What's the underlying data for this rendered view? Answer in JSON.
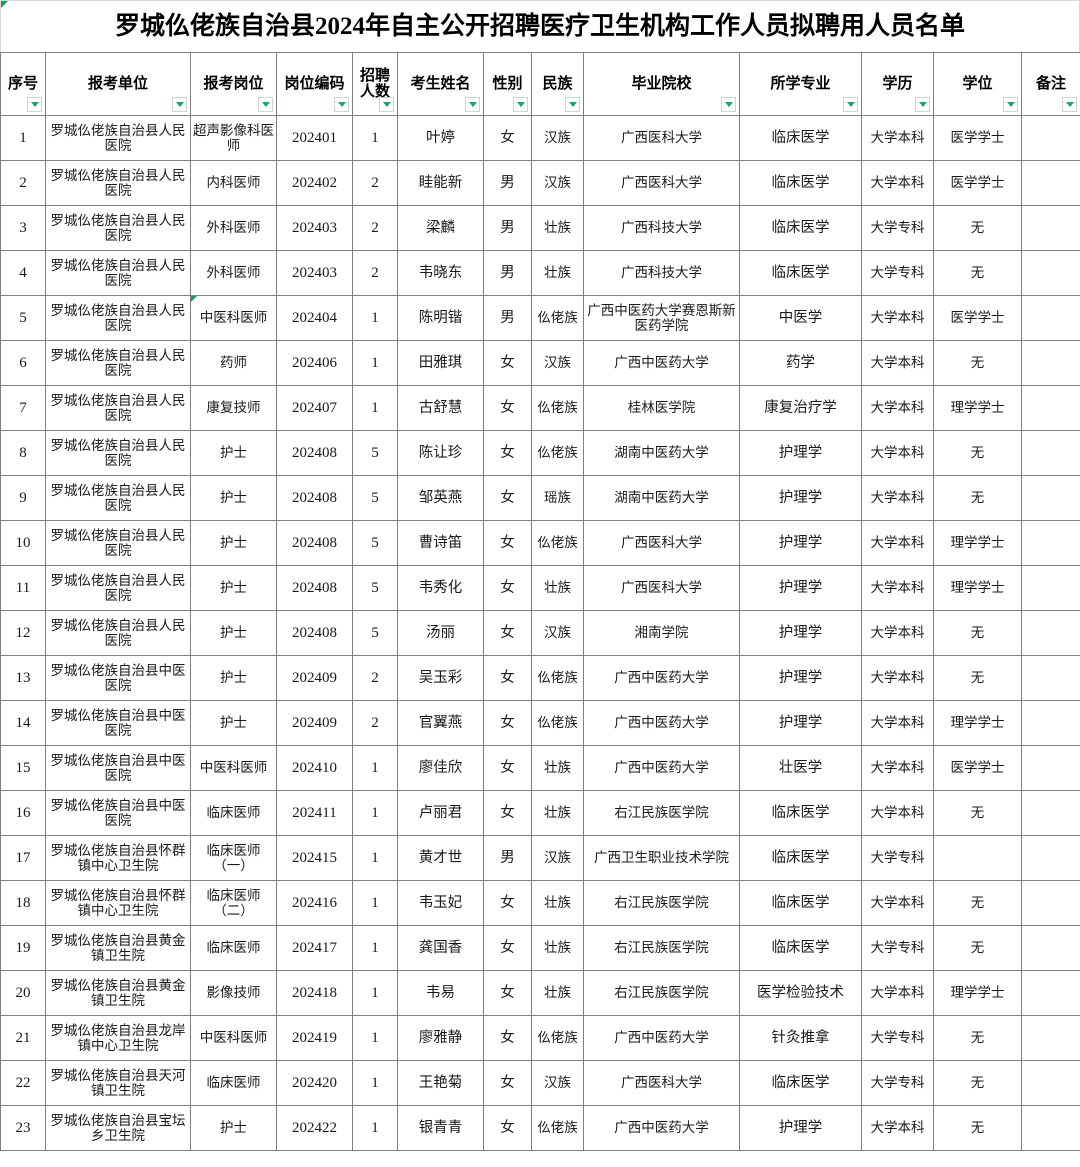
{
  "document": {
    "title": "罗城仫佬族自治县2024年自主公开招聘医疗卫生机构工作人员拟聘用人员名单",
    "accent_color": "#17a673",
    "grid_line_color": "#808080"
  },
  "table": {
    "headers": [
      "序号",
      "报考单位",
      "报考岗位",
      "岗位编码",
      "招聘人数",
      "考生姓名",
      "性别",
      "民族",
      "毕业院校",
      "所学专业",
      "学历",
      "学位",
      "备注"
    ],
    "header_lines": [
      [
        "序号"
      ],
      [
        "报考单位"
      ],
      [
        "报考岗位"
      ],
      [
        "岗位编码"
      ],
      [
        "招聘",
        "人数"
      ],
      [
        "考生姓名"
      ],
      [
        "性别"
      ],
      [
        "民族"
      ],
      [
        "毕业院校"
      ],
      [
        "所学专业"
      ],
      [
        "学历"
      ],
      [
        "学位"
      ],
      [
        "备注"
      ]
    ],
    "filter_icon": "filter-dropdown-icon",
    "rows": [
      {
        "index": "1",
        "unit": "罗城仫佬族自治县人民医院",
        "post": "超声影像科医师",
        "code": "202401",
        "count": "1",
        "name": "叶婷",
        "sex": "女",
        "ethnicity": "汉族",
        "school": "广西医科大学",
        "major": "临床医学",
        "education": "大学本科",
        "degree": "医学学士",
        "note": ""
      },
      {
        "index": "2",
        "unit": "罗城仫佬族自治县人民医院",
        "post": "内科医师",
        "code": "202402",
        "count": "2",
        "name": "眭能新",
        "sex": "男",
        "ethnicity": "汉族",
        "school": "广西医科大学",
        "major": "临床医学",
        "education": "大学本科",
        "degree": "医学学士",
        "note": ""
      },
      {
        "index": "3",
        "unit": "罗城仫佬族自治县人民医院",
        "post": "外科医师",
        "code": "202403",
        "count": "2",
        "name": "梁麟",
        "sex": "男",
        "ethnicity": "壮族",
        "school": "广西科技大学",
        "major": "临床医学",
        "education": "大学专科",
        "degree": "无",
        "note": ""
      },
      {
        "index": "4",
        "unit": "罗城仫佬族自治县人民医院",
        "post": "外科医师",
        "code": "202403",
        "count": "2",
        "name": "韦晓东",
        "sex": "男",
        "ethnicity": "壮族",
        "school": "广西科技大学",
        "major": "临床医学",
        "education": "大学专科",
        "degree": "无",
        "note": ""
      },
      {
        "index": "5",
        "unit": "罗城仫佬族自治县人民医院",
        "post": "中医科医师",
        "post_flag": true,
        "code": "202404",
        "count": "1",
        "name": "陈明锴",
        "sex": "男",
        "ethnicity": "仫佬族",
        "school": "广西中医药大学赛恩斯新医药学院",
        "major": "中医学",
        "education": "大学本科",
        "degree": "医学学士",
        "note": ""
      },
      {
        "index": "6",
        "unit": "罗城仫佬族自治县人民医院",
        "post": "药师",
        "code": "202406",
        "count": "1",
        "name": "田雅琪",
        "sex": "女",
        "ethnicity": "汉族",
        "school": "广西中医药大学",
        "major": "药学",
        "education": "大学本科",
        "degree": "无",
        "note": ""
      },
      {
        "index": "7",
        "unit": "罗城仫佬族自治县人民医院",
        "post": "康复技师",
        "code": "202407",
        "count": "1",
        "name": "古舒慧",
        "sex": "女",
        "ethnicity": "仫佬族",
        "school": "桂林医学院",
        "major": "康复治疗学",
        "education": "大学本科",
        "degree": "理学学士",
        "note": ""
      },
      {
        "index": "8",
        "unit": "罗城仫佬族自治县人民医院",
        "post": "护士",
        "code": "202408",
        "count": "5",
        "name": "陈让珍",
        "sex": "女",
        "ethnicity": "仫佬族",
        "school": "湖南中医药大学",
        "major": "护理学",
        "education": "大学本科",
        "degree": "无",
        "note": ""
      },
      {
        "index": "9",
        "unit": "罗城仫佬族自治县人民医院",
        "post": "护士",
        "code": "202408",
        "count": "5",
        "name": "邹英燕",
        "sex": "女",
        "ethnicity": "瑶族",
        "school": "湖南中医药大学",
        "major": "护理学",
        "education": "大学本科",
        "degree": "无",
        "note": ""
      },
      {
        "index": "10",
        "unit": "罗城仫佬族自治县人民医院",
        "post": "护士",
        "code": "202408",
        "count": "5",
        "name": "曹诗笛",
        "sex": "女",
        "ethnicity": "仫佬族",
        "school": "广西医科大学",
        "major": "护理学",
        "education": "大学本科",
        "degree": "理学学士",
        "note": ""
      },
      {
        "index": "11",
        "unit": "罗城仫佬族自治县人民医院",
        "post": "护士",
        "code": "202408",
        "count": "5",
        "name": "韦秀化",
        "sex": "女",
        "ethnicity": "壮族",
        "school": "广西医科大学",
        "major": "护理学",
        "education": "大学本科",
        "degree": "理学学士",
        "note": ""
      },
      {
        "index": "12",
        "unit": "罗城仫佬族自治县人民医院",
        "post": "护士",
        "code": "202408",
        "count": "5",
        "name": "汤丽",
        "sex": "女",
        "ethnicity": "汉族",
        "school": "湘南学院",
        "major": "护理学",
        "education": "大学本科",
        "degree": "无",
        "note": ""
      },
      {
        "index": "13",
        "unit": "罗城仫佬族自治县中医医院",
        "post": "护士",
        "code": "202409",
        "count": "2",
        "name": "吴玉彩",
        "sex": "女",
        "ethnicity": "仫佬族",
        "school": "广西中医药大学",
        "major": "护理学",
        "education": "大学本科",
        "degree": "无",
        "note": ""
      },
      {
        "index": "14",
        "unit": "罗城仫佬族自治县中医医院",
        "post": "护士",
        "code": "202409",
        "count": "2",
        "name": "官翼燕",
        "sex": "女",
        "ethnicity": "仫佬族",
        "school": "广西中医药大学",
        "major": "护理学",
        "education": "大学本科",
        "degree": "理学学士",
        "note": ""
      },
      {
        "index": "15",
        "unit": "罗城仫佬族自治县中医医院",
        "post": "中医科医师",
        "code": "202410",
        "count": "1",
        "name": "廖佳欣",
        "sex": "女",
        "ethnicity": "壮族",
        "school": "广西中医药大学",
        "major": "壮医学",
        "education": "大学本科",
        "degree": "医学学士",
        "note": ""
      },
      {
        "index": "16",
        "unit": "罗城仫佬族自治县中医医院",
        "post": "临床医师",
        "code": "202411",
        "count": "1",
        "name": "卢丽君",
        "sex": "女",
        "ethnicity": "壮族",
        "school": "右江民族医学院",
        "major": "临床医学",
        "education": "大学本科",
        "degree": "无",
        "note": ""
      },
      {
        "index": "17",
        "unit": "罗城仫佬族自治县怀群镇中心卫生院",
        "post": "临床医师（一）",
        "code": "202415",
        "count": "1",
        "name": "黄才世",
        "sex": "男",
        "ethnicity": "汉族",
        "school": "广西卫生职业技术学院",
        "major": "临床医学",
        "education": "大学专科",
        "degree": "",
        "note": ""
      },
      {
        "index": "18",
        "unit": "罗城仫佬族自治县怀群镇中心卫生院",
        "post": "临床医师（二）",
        "code": "202416",
        "count": "1",
        "name": "韦玉妃",
        "sex": "女",
        "ethnicity": "壮族",
        "school": "右江民族医学院",
        "major": "临床医学",
        "education": "大学本科",
        "degree": "无",
        "note": ""
      },
      {
        "index": "19",
        "unit": "罗城仫佬族自治县黄金镇卫生院",
        "post": "临床医师",
        "code": "202417",
        "count": "1",
        "name": "龚国香",
        "sex": "女",
        "ethnicity": "壮族",
        "school": "右江民族医学院",
        "major": "临床医学",
        "education": "大学专科",
        "degree": "无",
        "note": ""
      },
      {
        "index": "20",
        "unit": "罗城仫佬族自治县黄金镇卫生院",
        "post": "影像技师",
        "code": "202418",
        "count": "1",
        "name": "韦易",
        "sex": "女",
        "ethnicity": "壮族",
        "school": "右江民族医学院",
        "major": "医学检验技术",
        "education": "大学本科",
        "degree": "理学学士",
        "note": ""
      },
      {
        "index": "21",
        "unit": "罗城仫佬族自治县龙岸镇中心卫生院",
        "post": "中医科医师",
        "code": "202419",
        "count": "1",
        "name": "廖雅静",
        "sex": "女",
        "ethnicity": "仫佬族",
        "school": "广西中医药大学",
        "major": "针灸推拿",
        "education": "大学专科",
        "degree": "无",
        "note": ""
      },
      {
        "index": "22",
        "unit": "罗城仫佬族自治县天河镇卫生院",
        "post": "临床医师",
        "code": "202420",
        "count": "1",
        "name": "王艳菊",
        "sex": "女",
        "ethnicity": "汉族",
        "school": "广西医科大学",
        "major": "临床医学",
        "education": "大学专科",
        "degree": "无",
        "note": ""
      },
      {
        "index": "23",
        "unit": "罗城仫佬族自治县宝坛乡卫生院",
        "post": "护士",
        "code": "202422",
        "count": "1",
        "name": "银青青",
        "sex": "女",
        "ethnicity": "仫佬族",
        "school": "广西中医药大学",
        "major": "护理学",
        "education": "大学本科",
        "degree": "无",
        "note": ""
      }
    ]
  }
}
